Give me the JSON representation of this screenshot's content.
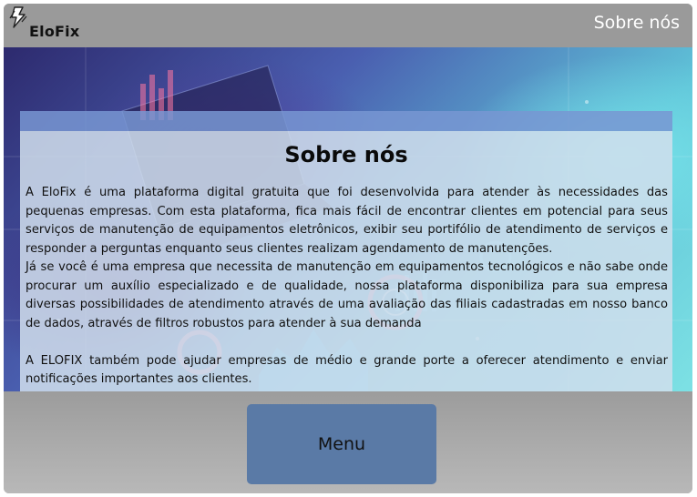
{
  "header": {
    "logo_text": "EloFix",
    "page_title": "Sobre nós"
  },
  "content": {
    "title": "Sobre nós",
    "paragraphs": [
      "A EloFix é uma plataforma digital gratuita que foi desenvolvida para atender às necessidades das pequenas empresas. Com esta plataforma, fica mais fácil de encontrar clientes em potencial para seus serviços de manutenção de equipamentos eletrônicos, exibir seu portifólio de atendimento de serviços e responder a perguntas enquanto seus clientes realizam agendamento de manutenções.",
      "Já se você é uma empresa que necessita de manutenção em equipamentos tecnológicos e não sabe onde procurar um auxílio especializado e de qualidade, nossa plataforma disponibiliza para sua empresa diversas possibilidades de atendimento através de uma avaliação das filiais cadastradas em nosso banco de dados, através de filtros robustos para atender à sua demanda",
      "A ELOFIX também pode ajudar empresas de médio e grande porte a oferecer atendimento e enviar notificações importantes aos clientes."
    ]
  },
  "footer": {
    "menu_label": "Menu"
  },
  "colors": {
    "header_bg": "#9a9a9a",
    "panel_bg": "#d0deec",
    "button_bg": "#5a7aa6"
  },
  "icons": {
    "logo": "lightning-bolt-icon"
  }
}
